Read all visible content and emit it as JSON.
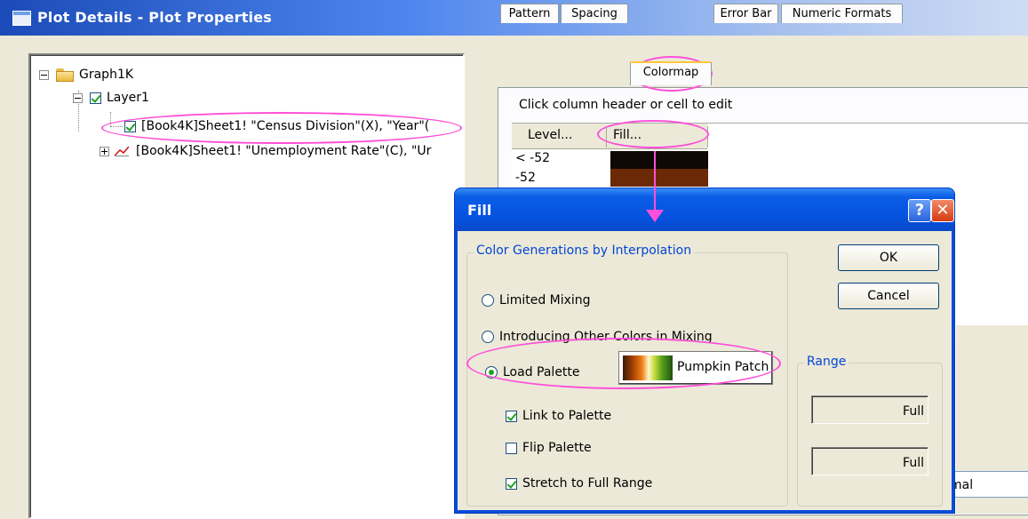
{
  "window": {
    "title": "Plot Details - Plot Properties"
  },
  "tree": {
    "graph": "Graph1K",
    "layer": "Layer1",
    "plot1": "[Book4K]Sheet1! \"Census Division\"(X), \"Year\"(",
    "plot2": "[Book4K]Sheet1! \"Unemployment Rate\"(C), \"Ur"
  },
  "tabs": [
    "Pattern",
    "Spacing",
    "Colormap",
    "Error Bar",
    "Numeric Formats"
  ],
  "active_tab": "Colormap",
  "colormap": {
    "hint": "Click column header or cell to edit",
    "columns": {
      "level": "Level...",
      "fill": "Fill..."
    },
    "rows": [
      {
        "level": "< -52",
        "color": "#100804"
      },
      {
        "level": "-52",
        "color": "#6b2a05"
      }
    ],
    "partial_value": "mal"
  },
  "fill_dialog": {
    "title": "Fill",
    "help_label": "?",
    "close_label": "✕",
    "group_label": "Color Generations by Interpolation",
    "options": {
      "limited": "Limited Mixing",
      "introducing": "Introducing Other Colors in Mixing",
      "load": "Load Palette"
    },
    "selected_option": "Load Palette",
    "palette_name": "Pumpkin Patch",
    "checks": {
      "link": {
        "label": "Link to Palette",
        "checked": true
      },
      "flip": {
        "label": "Flip Palette",
        "checked": false
      },
      "stretch": {
        "label": "Stretch to Full Range",
        "checked": true
      }
    },
    "ok_label": "OK",
    "cancel_label": "Cancel",
    "range": {
      "label": "Range",
      "from": "Full",
      "to": "Full"
    }
  },
  "colors": {
    "highlight": "#ff4fd8",
    "title_blue": "#0552de",
    "group_label_blue": "#0046d5"
  }
}
